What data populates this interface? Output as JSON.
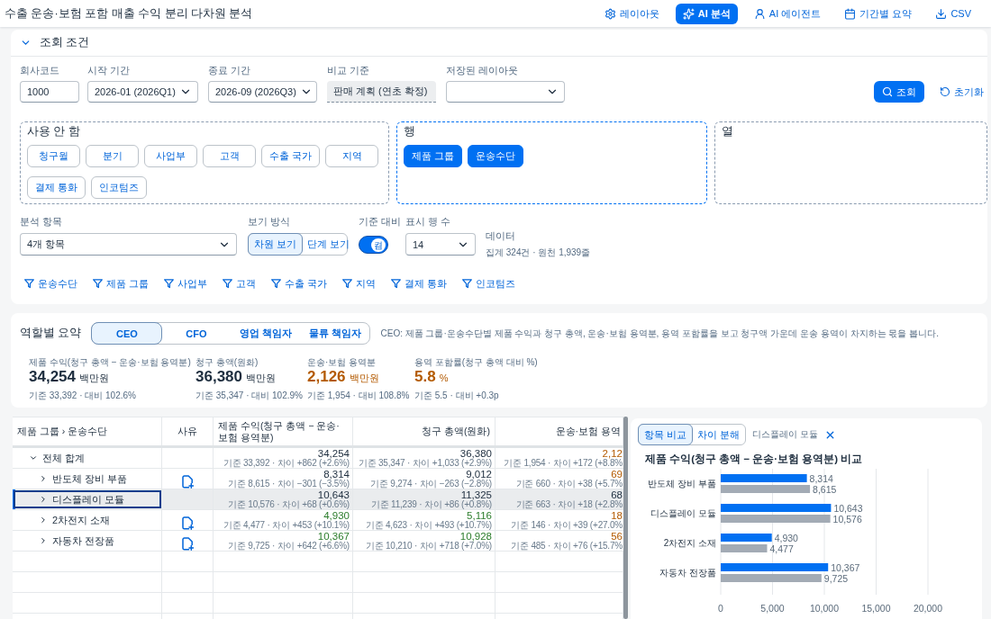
{
  "window": {
    "title": "수출 운송·보험 포함 매출 수익 분리 다차원 분석"
  },
  "toolbar": [
    {
      "kind": "layout",
      "label": "레이아웃",
      "selected": false
    },
    {
      "kind": "analysis",
      "label": "AI 분석",
      "selected": true
    },
    {
      "kind": "agent",
      "label": "AI 에이전트",
      "selected": false
    },
    {
      "kind": "summary",
      "label": "기간별 요약",
      "selected": false
    },
    {
      "kind": "export",
      "label": "CSV",
      "selected": false
    }
  ],
  "query_panel": {
    "title": "조회 조건",
    "expanded": true,
    "fields": [
      {
        "kind": "input",
        "label": "회사코드",
        "value": "1000"
      },
      {
        "kind": "select",
        "label": "시작 기간",
        "value": "2026-01 (2026Q1)"
      },
      {
        "kind": "select",
        "label": "종료 기간",
        "value": "2026-09 (2026Q3)"
      },
      {
        "kind": "readonly",
        "label": "비교 기준",
        "value": "판매 계획 (연초 확정)"
      },
      {
        "kind": "select",
        "label": "저장된 레이아웃"
      }
    ],
    "search_button": "조회",
    "reset_button": "초기화",
    "zones": [
      {
        "kind": "available",
        "title": "사용 안 함",
        "chips": [
          "청구월",
          "분기",
          "사업부",
          "고객",
          "수출 국가",
          "지역",
          "결제 통화",
          "인코텀즈"
        ]
      },
      {
        "kind": "rows",
        "title": "행",
        "chips": [
          "제품 그룹",
          "운송수단"
        ]
      },
      {
        "kind": "columns",
        "title": "열"
      }
    ],
    "measure": {
      "label": "분석 항목",
      "value": "4개 항목"
    },
    "view_mode": {
      "label": "보기 방식",
      "options": [
        {
          "label": "차원 보기",
          "selected": true
        },
        {
          "label": "단계 보기",
          "selected": false
        }
      ]
    },
    "baseline": {
      "label": "기준 대비",
      "on": true,
      "text": "켬"
    },
    "row_count": {
      "label": "표시 행 수",
      "value": "14"
    },
    "data_info": {
      "label": "데이터",
      "text": "집계 324건 · 원천 1,939줄"
    },
    "filters": [
      "운송수단",
      "제품 그룹",
      "사업부",
      "고객",
      "수출 국가",
      "지역",
      "결제 통화",
      "인코텀즈"
    ]
  },
  "role_summary": {
    "title": "역할별 요약",
    "tabs": [
      {
        "label": "CEO",
        "selected": true
      },
      {
        "label": "CFO",
        "selected": false
      },
      {
        "label": "영업 책임자",
        "selected": false
      },
      {
        "label": "물류 책임자",
        "selected": false
      }
    ],
    "description": "CEO: 제품 그룹·운송수단별 제품 수익과 청구 총액, 운송·보험 용역분, 용역 포함률을 보고 청구액 가운데 운송 용역이 차지하는 몫을 봅니다.",
    "kpis": [
      {
        "label": "제품 수익(청구 총액 − 운송·보험 용역분)",
        "value": "34,254",
        "unit": "백만원",
        "detail": "기준 33,392 · 대비 102.6%",
        "color": "#1d2d3e"
      },
      {
        "label": "청구 총액(원화)",
        "value": "36,380",
        "unit": "백만원",
        "detail": "기준 35,347 · 대비 102.9%",
        "color": "#1d2d3e"
      },
      {
        "label": "운송·보험 용역분",
        "value": "2,126",
        "unit": "백만원",
        "detail": "기준 1,954 · 대비 108.8%",
        "color": "#b35a00"
      },
      {
        "label": "용역 포함률(청구 총액 대비 %)",
        "value": "5.8",
        "unit": "%",
        "detail": "기준 5.5 · 대비 +0.3p",
        "color": "#b35a00"
      }
    ]
  },
  "table": {
    "columns": [
      "제품 그룹 › 운송수단",
      "사유",
      "제품 수익(청구 총액 − 운송·보험 용역분)",
      "청구 총액(원화)",
      "운송·보험 용역"
    ],
    "rows": [
      {
        "expanded": true,
        "selected": false,
        "cells": [
          {
            "kind": "label",
            "text": "전체 합계"
          },
          {
            "kind": "reason",
            "action": false
          },
          {
            "kind": "value",
            "value": "34,254",
            "detail": "기준 33,392 · 차이 +862 (+2.6%)",
            "color": "#1d2d3e"
          },
          {
            "kind": "value",
            "value": "36,380",
            "detail": "기준 35,347 · 차이 +1,033 (+2.9%)",
            "color": "#1d2d3e"
          },
          {
            "kind": "value",
            "value": "2,12",
            "detail": "기준 1,954 · 차이 +172 (+8.8%",
            "color": "#b35a00"
          }
        ],
        "children": [
          {
            "expanded": false,
            "selected": false,
            "cells": [
              {
                "kind": "label",
                "text": "반도체 장비 부품"
              },
              {
                "kind": "reason",
                "action": true
              },
              {
                "kind": "value",
                "value": "8,314",
                "detail": "기준 8,615 · 차이 −301 (−3.5%)",
                "color": "#1d2d3e"
              },
              {
                "kind": "value",
                "value": "9,012",
                "detail": "기준 9,274 · 차이 −263 (−2.8%)",
                "color": "#1d2d3e"
              },
              {
                "kind": "value",
                "value": "69",
                "detail": "기준 660 · 차이 +38 (+5.7%",
                "color": "#b35a00"
              }
            ]
          },
          {
            "expanded": false,
            "selected": true,
            "cells": [
              {
                "kind": "label",
                "text": "디스플레이 모듈"
              },
              {
                "kind": "reason",
                "action": false
              },
              {
                "kind": "value",
                "value": "10,643",
                "detail": "기준 10,576 · 차이 +68 (+0.6%)",
                "color": "#1d2d3e"
              },
              {
                "kind": "value",
                "value": "11,325",
                "detail": "기준 11,239 · 차이 +86 (+0.8%)",
                "color": "#1d2d3e"
              },
              {
                "kind": "value",
                "value": "68",
                "detail": "기준 663 · 차이 +18 (+2.8%",
                "color": "#1d2d3e"
              }
            ]
          },
          {
            "expanded": false,
            "selected": false,
            "cells": [
              {
                "kind": "label",
                "text": "2차전지 소재"
              },
              {
                "kind": "reason",
                "action": true
              },
              {
                "kind": "value",
                "value": "4,930",
                "detail": "기준 4,477 · 차이 +453 (+10.1%)",
                "color": "#2b7c2b"
              },
              {
                "kind": "value",
                "value": "5,116",
                "detail": "기준 4,623 · 차이 +493 (+10.7%)",
                "color": "#2b7c2b"
              },
              {
                "kind": "value",
                "value": "18",
                "detail": "기준 146 · 차이 +39 (+27.0%",
                "color": "#b35a00"
              }
            ]
          },
          {
            "expanded": false,
            "selected": false,
            "cells": [
              {
                "kind": "label",
                "text": "자동차 전장품"
              },
              {
                "kind": "reason",
                "action": true
              },
              {
                "kind": "value",
                "value": "10,367",
                "detail": "기준 9,725 · 차이 +642 (+6.6%)",
                "color": "#2b7c2b"
              },
              {
                "kind": "value",
                "value": "10,928",
                "detail": "기준 10,210 · 차이 +718 (+7.0%)",
                "color": "#2b7c2b"
              },
              {
                "kind": "value",
                "value": "56",
                "detail": "기준 485 · 차이 +76 (+15.7%",
                "color": "#b35a00"
              }
            ]
          }
        ]
      }
    ]
  },
  "chart_panel": {
    "tabs": [
      {
        "label": "항목 비교",
        "selected": true
      },
      {
        "label": "차이 분해",
        "selected": false
      }
    ],
    "focus": "디스플레이 모듈",
    "chart_data": {
      "type": "bar",
      "orientation": "horizontal",
      "title": "제품 수익(청구 총액 − 운송·보험 용역분) 비교",
      "categories": [
        "반도체 장비 부품",
        "디스플레이 모듈",
        "2차전지 소재",
        "자동차 전장품"
      ],
      "series": [
        {
          "color": "#0070f2",
          "values": [
            8314,
            10643,
            4930,
            10367
          ]
        },
        {
          "color": "#a3abb5",
          "values": [
            8615,
            10576,
            4477,
            9725
          ]
        }
      ],
      "xlim": [
        0,
        20000
      ],
      "xticks": [
        {
          "value": 0,
          "label": "0"
        },
        {
          "value": 5000,
          "label": "5,000"
        },
        {
          "value": 10000,
          "label": "10,000"
        },
        {
          "value": 15000,
          "label": "15,000"
        },
        {
          "value": 20000,
          "label": "20,000"
        }
      ],
      "grid": true,
      "value_labels": [
        [
          "8,314",
          "10,643",
          "4,930",
          "10,367"
        ],
        [
          "8,615",
          "10,576",
          "4,477",
          "9,725"
        ]
      ]
    }
  }
}
